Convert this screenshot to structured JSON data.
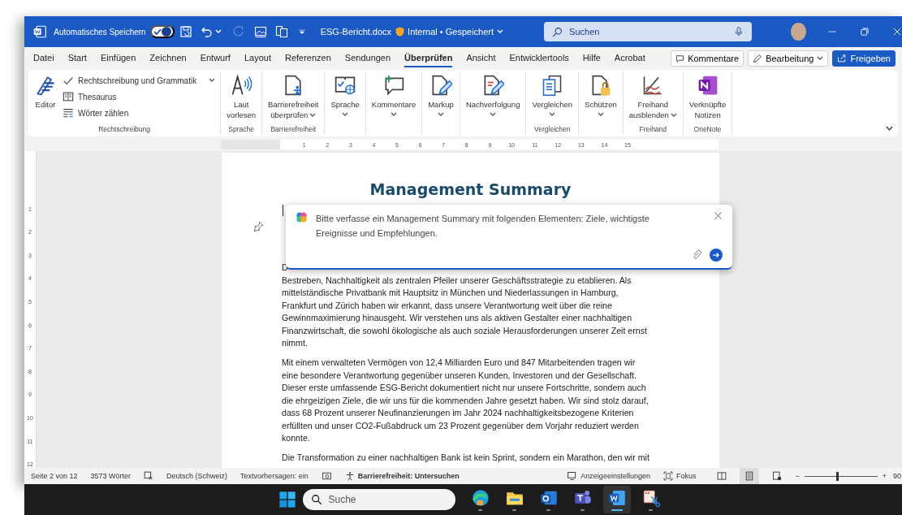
{
  "title_bar": {
    "autosave_label": "Automatisches Speichern",
    "autosave_on": true,
    "redo_disabled": true,
    "document_name": "ESG-Bericht.docx",
    "status": "Internal • Gespeichert",
    "search_placeholder": "Suchen"
  },
  "menu_tabs": [
    {
      "label": "Datei",
      "selected": false
    },
    {
      "label": "Start",
      "selected": false
    },
    {
      "label": "Einfügen",
      "selected": false
    },
    {
      "label": "Zeichnen",
      "selected": false
    },
    {
      "label": "Entwurf",
      "selected": false
    },
    {
      "label": "Layout",
      "selected": false
    },
    {
      "label": "Referenzen",
      "selected": false
    },
    {
      "label": "Sendungen",
      "selected": false
    },
    {
      "label": "Überprüfen",
      "selected": true
    },
    {
      "label": "Ansicht",
      "selected": false
    },
    {
      "label": "Entwicklertools",
      "selected": false
    },
    {
      "label": "Hilfe",
      "selected": false
    },
    {
      "label": "Acrobat",
      "selected": false
    }
  ],
  "header_buttons": [
    {
      "kind": "outline",
      "label": "Kommentare",
      "dropdown": false
    },
    {
      "kind": "outline",
      "label": "Bearbeitung",
      "dropdown": true
    },
    {
      "kind": "primary",
      "label": "Freigeben",
      "dropdown": false
    }
  ],
  "ribbon_groups": [
    {
      "label": "Rechtschreibung",
      "commands": [
        {
          "kind": "large",
          "label": "Editor",
          "dropdown": false
        },
        {
          "kind": "small",
          "label": "Rechtschreibung und Grammatik",
          "dropdown": true
        },
        {
          "kind": "small",
          "label": "Thesaurus",
          "dropdown": false
        },
        {
          "kind": "small",
          "label": "Wörter zählen",
          "dropdown": false
        }
      ]
    },
    {
      "label": "Sprache",
      "commands": [
        {
          "kind": "large",
          "label": "Laut\nvorlesen",
          "dropdown": false
        }
      ]
    },
    {
      "label": "Barrierefreiheit",
      "commands": [
        {
          "kind": "large",
          "label": "Barrierefreiheit\nüberprüfen",
          "dropdown": true
        }
      ]
    },
    {
      "commands": [
        {
          "kind": "large",
          "label": "Sprache",
          "dropdown": true
        }
      ]
    },
    {
      "commands": [
        {
          "kind": "large",
          "label": "Kommentare",
          "dropdown": true
        }
      ]
    },
    {
      "commands": [
        {
          "kind": "large",
          "label": "Markup",
          "dropdown": true
        }
      ]
    },
    {
      "commands": [
        {
          "kind": "large",
          "label": "Nachverfolgung",
          "dropdown": true
        }
      ]
    },
    {
      "label": "Vergleichen",
      "commands": [
        {
          "kind": "large",
          "label": "Vergleichen",
          "dropdown": true
        }
      ]
    },
    {
      "commands": [
        {
          "kind": "large",
          "label": "Schützen",
          "dropdown": true
        }
      ]
    },
    {
      "label": "Freihand",
      "commands": [
        {
          "kind": "large",
          "label": "Freihand\nausblenden",
          "dropdown": true
        }
      ]
    },
    {
      "label": "OneNote",
      "commands": [
        {
          "kind": "large",
          "label": "Verknüpfte\nNotizen",
          "dropdown": false
        }
      ]
    }
  ],
  "ruler": {
    "horizontal_numbers": [
      "1",
      "2",
      "3",
      "4",
      "5",
      "6",
      "7",
      "8",
      "9",
      "10",
      "11",
      "12",
      "13",
      "14",
      "15"
    ],
    "vertical_numbers": [
      "1",
      "2",
      "3",
      "4",
      "5",
      "6",
      "7",
      "8",
      "9",
      "10",
      "11",
      "12"
    ]
  },
  "document": {
    "heading": "Management Summary",
    "paragraphs": [
      {
        "lines": [
          "D",
          "Bestreben, Nachhaltigkeit als zentralen Pfeiler unserer Geschäftsstrategie zu etablieren. Als",
          "mittelständische Privatbank mit Hauptsitz in München und Niederlassungen in Hamburg,",
          "Frankfurt und Zürich haben wir erkannt, dass unsere Verantwortung weit über die reine",
          "Gewinnmaximierung hinausgeht. Wir verstehen uns als aktiven Gestalter einer nachhaltigen",
          "Finanzwirtschaft, die sowohl ökologische als auch soziale Herausforderungen unserer Zeit ernst",
          "nimmt."
        ]
      },
      {
        "lines": [
          "Mit einem verwalteten Vermögen von 12,4 Milliarden Euro und 847 Mitarbeitenden tragen wir",
          "eine besondere Verantwortung gegenüber unseren Kunden, Investoren und der Gesellschaft.",
          "Dieser erste umfassende ESG-Bericht dokumentiert nicht nur unsere Fortschritte, sondern auch",
          "die ehrgeizigen Ziele, die wir uns für die kommenden Jahre gesetzt haben. Wir sind stolz darauf,",
          "dass 68 Prozent unserer Neufinanzierungen im Jahr 2024 nachhaltigkeitsbezogene Kriterien",
          "erfüllten und unser CO2-Fußabdruck um 23 Prozent gegenüber dem Vorjahr reduziert werden",
          "konnte."
        ]
      },
      {
        "lines": [
          "Die Transformation zu einer nachhaltigen Bank ist kein Sprint, sondern ein Marathon, den wir mit"
        ]
      }
    ],
    "prompt": {
      "lines": [
        "Bitte verfasse ein Management Summary mit folgenden Elementen: Ziele, wichtigste",
        "Ereignisse und Empfehlungen."
      ]
    }
  },
  "status_bar": {
    "page": "Seite 2 von 12",
    "words": "3573 Wörter",
    "language": "Deutsch (Schweiz)",
    "text_predictions": "Textvorhersagen: ein",
    "accessibility": "Barrierefreiheit: Untersuchen",
    "display_settings": "Anzeigeeinstellungen",
    "focus": "Fokus",
    "views": [
      {
        "selected": false
      },
      {
        "selected": true
      },
      {
        "selected": false
      }
    ],
    "zoom": {
      "minus": "−",
      "plus": "+",
      "level": 0.45,
      "value": "90"
    }
  },
  "taskbar": {
    "search_placeholder": "Suche",
    "apps": [
      {
        "selected": false
      },
      {
        "selected": false
      },
      {
        "selected": false
      },
      {
        "selected": false
      },
      {
        "selected": true
      },
      {
        "selected": false
      }
    ]
  }
}
